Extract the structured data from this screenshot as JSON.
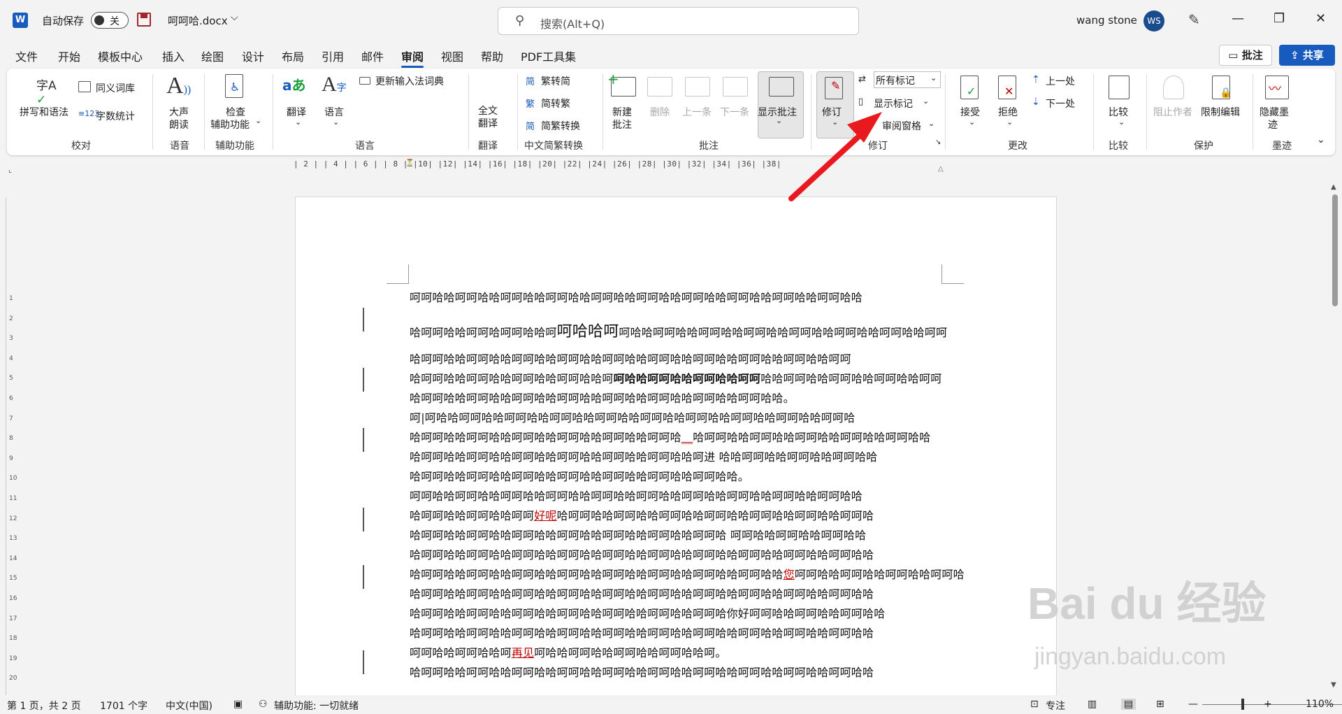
{
  "titlebar": {
    "app_logo": "W",
    "autosave_label": "自动保存",
    "autosave_state": "关",
    "doc_title": "呵呵哈.docx",
    "search_placeholder": "搜索(Alt+Q)",
    "username": "wang stone",
    "avatar_initials": "WS"
  },
  "menu": {
    "items": [
      "文件",
      "开始",
      "模板中心",
      "插入",
      "绘图",
      "设计",
      "布局",
      "引用",
      "邮件",
      "审阅",
      "视图",
      "帮助",
      "PDF工具集"
    ],
    "active": "审阅",
    "comment_btn": "批注",
    "share_btn": "共享"
  },
  "ribbon": {
    "proofing": {
      "spell": "拼写和语法",
      "thesaurus": "同义词库",
      "wordcount": "字数统计",
      "group": "校对"
    },
    "speech": {
      "readaloud_1": "大声",
      "readaloud_2": "朗读",
      "group": "语音"
    },
    "accessibility": {
      "check_1": "检查",
      "check_2": "辅助功能",
      "group": "辅助功能"
    },
    "language": {
      "translate": "翻译",
      "language": "语言",
      "update_ime": "更新输入法词典",
      "group": "语言"
    },
    "translate": {
      "full_1": "全文",
      "full_2": "翻译",
      "group": "翻译"
    },
    "chinese": {
      "t2s": "繁转简",
      "s2t": "简转繁",
      "convert": "简繁转换",
      "group": "中文简繁转换"
    },
    "comments": {
      "new_1": "新建",
      "new_2": "批注",
      "delete": "删除",
      "prev": "上一条",
      "next": "下一条",
      "show": "显示批注",
      "group": "批注"
    },
    "tracking": {
      "track": "修订",
      "markup_select": "所有标记",
      "show_markup": "显示标记",
      "review_pane": "审阅窗格",
      "group": "修订"
    },
    "changes": {
      "accept": "接受",
      "reject": "拒绝",
      "prev": "上一处",
      "next": "下一处",
      "group": "更改"
    },
    "compare": {
      "compare": "比较",
      "group": "比较"
    },
    "protect": {
      "block": "阻止作者",
      "restrict": "限制编辑",
      "group": "保护"
    },
    "ink": {
      "hide_1": "隐藏墨",
      "hide_2": "迹",
      "group": "墨迹"
    }
  },
  "ruler": {
    "h_labels": "| 2 |  | 4 |  | 6 |  | 8 |  |10|  |12|  |14|  |16|  |18|  |20|  |22|  |24|  |26|  |28|  |30|  |32|  |34|  |36|  |38|",
    "v_labels": [
      "1",
      "2",
      "3",
      "4",
      "5",
      "6",
      "7",
      "8",
      "9",
      "10",
      "11",
      "12",
      "13",
      "14",
      "15",
      "16",
      "17",
      "18",
      "19",
      "20"
    ]
  },
  "document": {
    "lines": [
      {
        "segments": [
          {
            "t": "呵呵哈哈呵呵哈哈呵呵哈哈呵呵哈哈呵呵哈哈呵呵哈哈呵呵哈哈呵呵哈哈呵呵哈哈呵呵哈哈"
          }
        ]
      },
      {
        "segments": [
          {
            "t": "哈呵呵哈哈呵呵哈呵呵哈哈呵"
          },
          {
            "t": "呵哈哈呵",
            "s": "big"
          },
          {
            "t": "呵哈哈呵呵哈哈呵呵哈哈呵呵哈哈呵呵哈哈呵呵哈哈呵呵哈哈呵呵"
          }
        ]
      },
      {
        "segments": [
          {
            "t": "哈呵呵哈哈呵呵哈哈呵呵哈哈呵呵哈哈呵呵哈哈呵呵哈哈呵呵哈哈呵呵哈哈呵呵哈哈呵呵"
          }
        ]
      },
      {
        "segments": [
          {
            "t": "哈呵呵哈哈呵呵哈哈呵呵哈哈呵呵哈哈呵"
          },
          {
            "t": "呵哈哈呵呵哈哈呵呵哈哈呵呵",
            "s": "b"
          },
          {
            "t": "哈哈呵呵哈哈呵呵哈哈呵呵哈哈呵呵"
          }
        ]
      },
      {
        "segments": [
          {
            "t": "哈呵呵哈哈呵呵哈哈呵呵哈哈呵呵哈哈呵呵哈哈呵呵哈哈呵呵哈哈呵呵哈哈。"
          }
        ]
      },
      {
        "segments": [
          {
            "t": "呵|呵哈哈呵呵哈哈呵呵哈哈呵呵哈哈呵呵哈哈呵呵哈哈呵呵哈哈呵呵哈哈呵呵哈哈呵呵哈"
          }
        ]
      },
      {
        "segments": [
          {
            "t": "哈呵呵哈哈呵呵哈哈呵呵哈哈呵呵哈哈呵呵哈哈呵呵哈"
          },
          {
            "t": "__",
            "s": "rev"
          },
          {
            "t": "哈呵呵哈哈呵呵哈哈呵呵哈哈呵呵哈哈呵呵哈哈"
          }
        ]
      },
      {
        "segments": [
          {
            "t": "哈呵呵哈哈呵呵哈哈呵呵哈哈呵呵哈哈呵呵哈哈呵呵哈哈呵进  哈哈呵呵哈哈呵呵哈哈呵呵哈哈"
          }
        ]
      },
      {
        "segments": [
          {
            "t": "哈呵呵哈哈呵呵哈哈呵呵哈哈呵呵哈哈呵呵哈哈呵呵哈哈呵呵哈哈。"
          }
        ]
      },
      {
        "segments": [
          {
            "t": "呵呵哈哈呵呵哈哈呵呵哈哈呵呵哈哈呵呵哈哈呵呵哈哈呵呵哈哈呵呵哈哈呵呵哈哈呵呵哈哈"
          }
        ]
      },
      {
        "segments": [
          {
            "t": "哈呵呵哈哈呵呵哈哈呵呵"
          },
          {
            "t": "好呢",
            "s": "rev"
          },
          {
            "t": "哈呵呵哈哈呵呵哈哈呵呵哈哈呵呵哈哈呵呵哈哈呵呵哈哈呵呵哈"
          }
        ]
      },
      {
        "segments": [
          {
            "t": "哈呵呵哈哈呵呵哈哈呵呵哈哈呵呵哈哈呵呵哈哈呵呵哈哈呵呵哈    呵呵哈哈呵呵哈哈呵呵哈哈"
          }
        ]
      },
      {
        "segments": [
          {
            "t": "哈呵呵哈哈呵呵哈哈呵呵哈哈呵呵哈哈呵呵哈哈呵呵哈哈呵呵哈哈呵呵哈哈呵呵哈哈呵呵哈哈"
          }
        ]
      },
      {
        "segments": [
          {
            "t": "哈呵呵哈哈呵呵哈哈呵呵哈哈呵呵哈哈呵呵哈哈呵呵哈哈呵呵哈哈呵呵哈哈"
          },
          {
            "t": "您",
            "s": "rev"
          },
          {
            "t": "呵呵哈哈呵呵哈哈呵呵哈哈呵呵哈"
          }
        ]
      },
      {
        "segments": [
          {
            "t": "哈呵呵哈哈呵呵哈哈呵呵哈哈呵呵哈哈呵呵哈哈呵呵哈哈呵呵哈哈呵呵哈哈呵呵哈哈呵呵哈哈"
          }
        ]
      },
      {
        "segments": [
          {
            "t": "哈呵呵哈哈呵呵哈哈呵呵哈哈呵呵哈哈呵呵哈哈呵呵哈哈呵呵哈你好呵呵哈哈呵呵哈哈呵呵哈哈"
          }
        ]
      },
      {
        "segments": [
          {
            "t": "哈呵呵哈哈呵呵哈哈呵呵哈哈呵呵哈哈呵呵哈哈呵呵哈哈呵呵哈哈呵呵哈哈呵呵哈哈呵呵哈哈"
          }
        ]
      },
      {
        "segments": [
          {
            "t": "呵呵哈哈呵呵哈哈呵"
          },
          {
            "t": "再见",
            "s": "rev"
          },
          {
            "t": "呵哈哈呵呵哈哈呵呵哈哈呵呵哈哈呵。"
          }
        ]
      },
      {
        "segments": [
          {
            "t": "哈呵呵哈哈呵呵哈哈呵呵哈哈呵呵哈哈呵呵哈哈呵呵哈哈呵呵哈哈呵呵哈哈呵呵哈哈呵呵哈哈"
          }
        ]
      }
    ]
  },
  "statusbar": {
    "page": "第 1 页，共 2 页",
    "words": "1701 个字",
    "lang": "中文(中国)",
    "access": "辅助功能: 一切就绪",
    "focus": "专注",
    "zoom": "110%"
  },
  "watermark": {
    "brand": "Bai du 经验",
    "url": "jingyan.baidu.com"
  },
  "colors": {
    "accent": "#185abd",
    "revision": "#c00000",
    "arrow": "#e8191f"
  }
}
